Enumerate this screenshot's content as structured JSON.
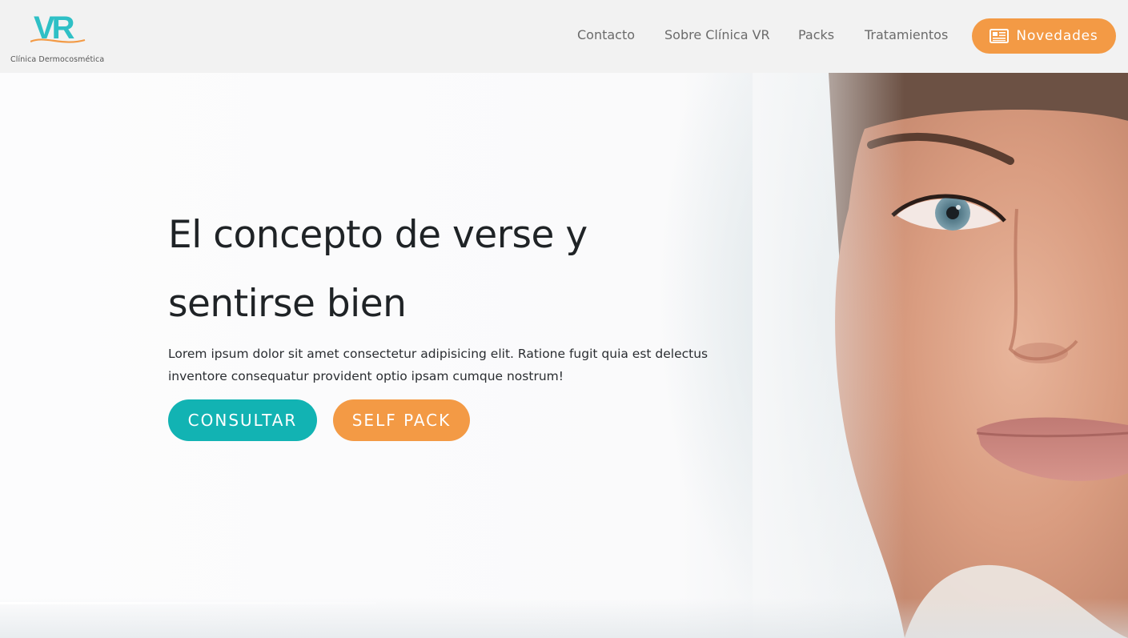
{
  "brand": {
    "logo_text": "VR",
    "subtitle": "Clínica Dermocosmética",
    "colors": {
      "teal": "#12b3b3",
      "orange": "#f39a45"
    }
  },
  "nav": {
    "items": [
      {
        "label": "Contacto"
      },
      {
        "label": "Sobre Clínica VR"
      },
      {
        "label": "Packs"
      },
      {
        "label": "Tratamientos"
      }
    ],
    "cta": {
      "label": "Novedades",
      "icon": "newspaper-icon"
    }
  },
  "hero": {
    "headline_line1": "El concepto de verse y",
    "headline_line2": "sentirse bien",
    "lead": "Lorem ipsum dolor sit amet consectetur adipisicing elit. Ratione fugit quia est delectus inventore consequatur provident optio ipsam cumque nostrum!",
    "primary_button": "CONSULTAR",
    "secondary_button": "SELF PACK"
  }
}
